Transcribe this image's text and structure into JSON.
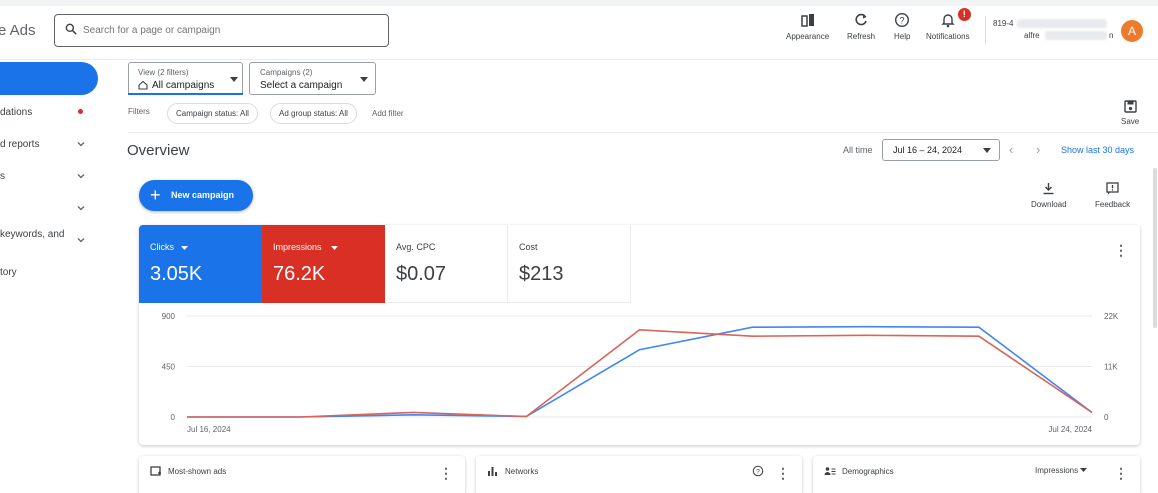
{
  "app": {
    "title_fragment": "e Ads"
  },
  "search": {
    "placeholder": "Search for a page or campaign"
  },
  "toolbar": {
    "appearance": "Appearance",
    "refresh": "Refresh",
    "help": "Help",
    "notifications": "Notifications",
    "notification_badge": "!"
  },
  "account": {
    "id_prefix": "819-4",
    "email_prefix": "alfre",
    "email_suffix": "n",
    "avatar_letter": "A",
    "avatar_color": "#ee7b2c"
  },
  "sidebar": {
    "items": [
      {
        "label": "dations"
      },
      {
        "label": "d reports"
      },
      {
        "label": "s"
      },
      {
        "label": ""
      },
      {
        "label": "keywords, and"
      },
      {
        "label": "tory"
      }
    ]
  },
  "filters_bar": {
    "view_small": "View (2 filters)",
    "view_value": "All campaigns",
    "campaigns_small": "Campaigns (2)",
    "campaigns_value": "Select a campaign",
    "filters_label": "Filters",
    "chips": [
      "Campaign status: All",
      "Ad group status: All"
    ],
    "add_filter": "Add filter",
    "save": "Save"
  },
  "overview": {
    "title": "Overview",
    "all_time": "All time",
    "date_range": "Jul 16 – 24, 2024",
    "show_last": "Show last 30 days",
    "new_campaign": "New campaign",
    "download": "Download",
    "feedback": "Feedback"
  },
  "metrics": [
    {
      "label": "Clicks",
      "value": "3.05K",
      "color": "#1a73e8"
    },
    {
      "label": "Impressions",
      "value": "76.2K",
      "color": "#d93025"
    },
    {
      "label": "Avg. CPC",
      "value": "$0.07"
    },
    {
      "label": "Cost",
      "value": "$213"
    }
  ],
  "chart_data": {
    "type": "line",
    "x": [
      "Jul 16, 2024",
      "Jul 17, 2024",
      "Jul 18, 2024",
      "Jul 19, 2024",
      "Jul 20, 2024",
      "Jul 21, 2024",
      "Jul 22, 2024",
      "Jul 23, 2024",
      "Jul 24, 2024"
    ],
    "x_tick_labels": [
      "Jul 16, 2024",
      "Jul 24, 2024"
    ],
    "series": [
      {
        "name": "Clicks",
        "axis": "left",
        "color": "#4285f4",
        "values": [
          0,
          0,
          20,
          5,
          600,
          800,
          805,
          800,
          40
        ]
      },
      {
        "name": "Impressions",
        "axis": "right",
        "color": "#d96459",
        "values": [
          0,
          0,
          1000,
          100,
          19000,
          17600,
          17800,
          17600,
          1000
        ]
      }
    ],
    "y_left": {
      "ylim": [
        0,
        900
      ],
      "ticks": [
        "900",
        "450",
        "0"
      ]
    },
    "y_right": {
      "ylim": [
        0,
        22000
      ],
      "ticks": [
        "22K",
        "11K",
        "0"
      ]
    },
    "grid": true
  },
  "bottom_cards": [
    {
      "title": "Most-shown ads"
    },
    {
      "title": "Networks"
    },
    {
      "title": "Demographics",
      "dropdown": "Impressions"
    }
  ]
}
